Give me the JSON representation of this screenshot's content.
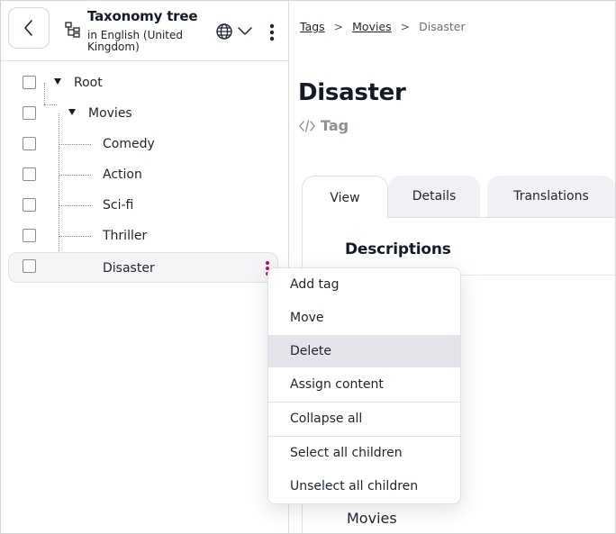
{
  "sidebar": {
    "header": {
      "title": "Taxonomy tree",
      "subtitle": "in English (United Kingdom)"
    },
    "tree": [
      {
        "label": "Root",
        "level": 0,
        "expanded": true
      },
      {
        "label": "Movies",
        "level": 1,
        "expanded": true
      },
      {
        "label": "Comedy",
        "level": 2
      },
      {
        "label": "Action",
        "level": 2
      },
      {
        "label": "Sci-fi",
        "level": 2
      },
      {
        "label": "Thriller",
        "level": 2
      },
      {
        "label": "Disaster",
        "level": 2,
        "selected": true
      }
    ]
  },
  "breadcrumb": {
    "items": [
      "Tags",
      "Movies"
    ],
    "separator": ">",
    "current": "Disaster"
  },
  "main": {
    "title": "Disaster",
    "content_type": "Tag",
    "tabs": [
      "View",
      "Details",
      "Translations"
    ],
    "active_tab": "View",
    "section_title": "Descriptions",
    "partial_value": "Movies"
  },
  "context_menu": {
    "items": [
      "Add tag",
      "Move",
      "Delete",
      "Assign content",
      "Collapse all",
      "Select all children",
      "Unselect all children"
    ],
    "hovered": "Delete"
  },
  "icons": {
    "back": "chevron-left-icon",
    "tree": "taxonomy-tree-icon",
    "language": "globe-icon",
    "dropdown": "chevron-down-icon",
    "more": "kebab-icon",
    "content_type": "code-icon"
  },
  "colors": {
    "accent": "#ae1164",
    "hover": "#e4e4ea",
    "tab_inactive": "#f1f1f5",
    "muted_text": "#8b8f96"
  }
}
